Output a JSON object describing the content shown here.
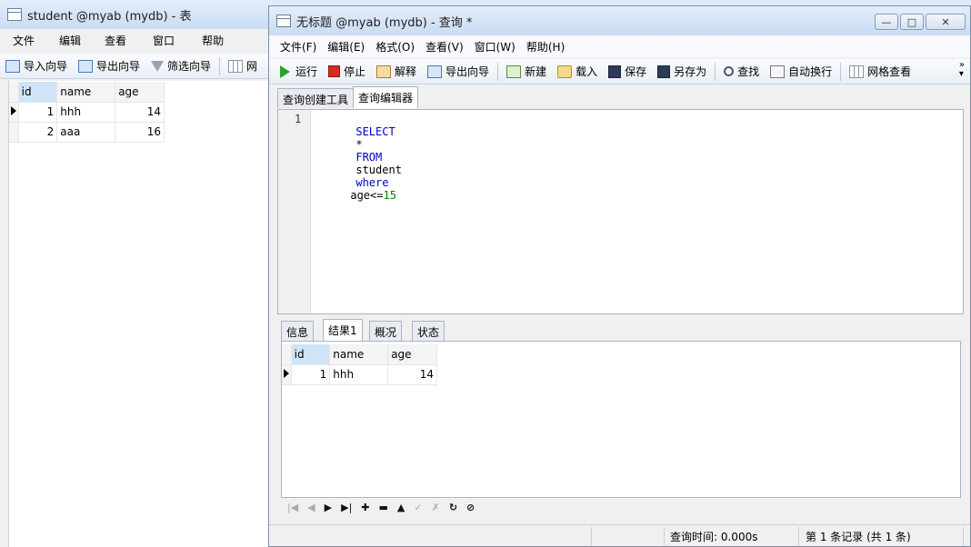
{
  "left_window": {
    "title": "student @myab (mydb) - 表",
    "menu": [
      "文件",
      "编辑",
      "查看",
      "窗口",
      "帮助"
    ],
    "toolbar": [
      "导入向导",
      "导出向导",
      "筛选向导",
      "网"
    ],
    "columns": [
      "id",
      "name",
      "age"
    ],
    "rows": [
      {
        "id": "1",
        "name": "hhh",
        "age": "14"
      },
      {
        "id": "2",
        "name": "aaa",
        "age": "16"
      }
    ]
  },
  "query_window": {
    "title": "无标题 @myab (mydb) - 查询 *",
    "menu": [
      "文件(F)",
      "编辑(E)",
      "格式(O)",
      "查看(V)",
      "窗口(W)",
      "帮助(H)"
    ],
    "toolbar": [
      "运行",
      "停止",
      "解释",
      "导出向导",
      "新建",
      "载入",
      "保存",
      "另存为",
      "查找",
      "自动换行",
      "网格查看"
    ],
    "editor_tabs": [
      "查询创建工具",
      "查询编辑器"
    ],
    "editor": {
      "line_number": "1",
      "kw_select": "SELECT",
      "star": "*",
      "kw_from": "FROM",
      "table": "student",
      "kw_where": "where",
      "cond": "age<=",
      "value": "15"
    },
    "result_tabs": [
      "信息",
      "结果1",
      "概况",
      "状态"
    ],
    "result_columns": [
      "id",
      "name",
      "age"
    ],
    "result_rows": [
      {
        "id": "1",
        "name": "hhh",
        "age": "14"
      }
    ],
    "status_time": "查询时间: 0.000s",
    "status_records": "第 1 条记录 (共 1 条)"
  },
  "colors": {
    "accent": "#cfe5f7",
    "keyword": "#0000c0",
    "number": "#008000"
  }
}
